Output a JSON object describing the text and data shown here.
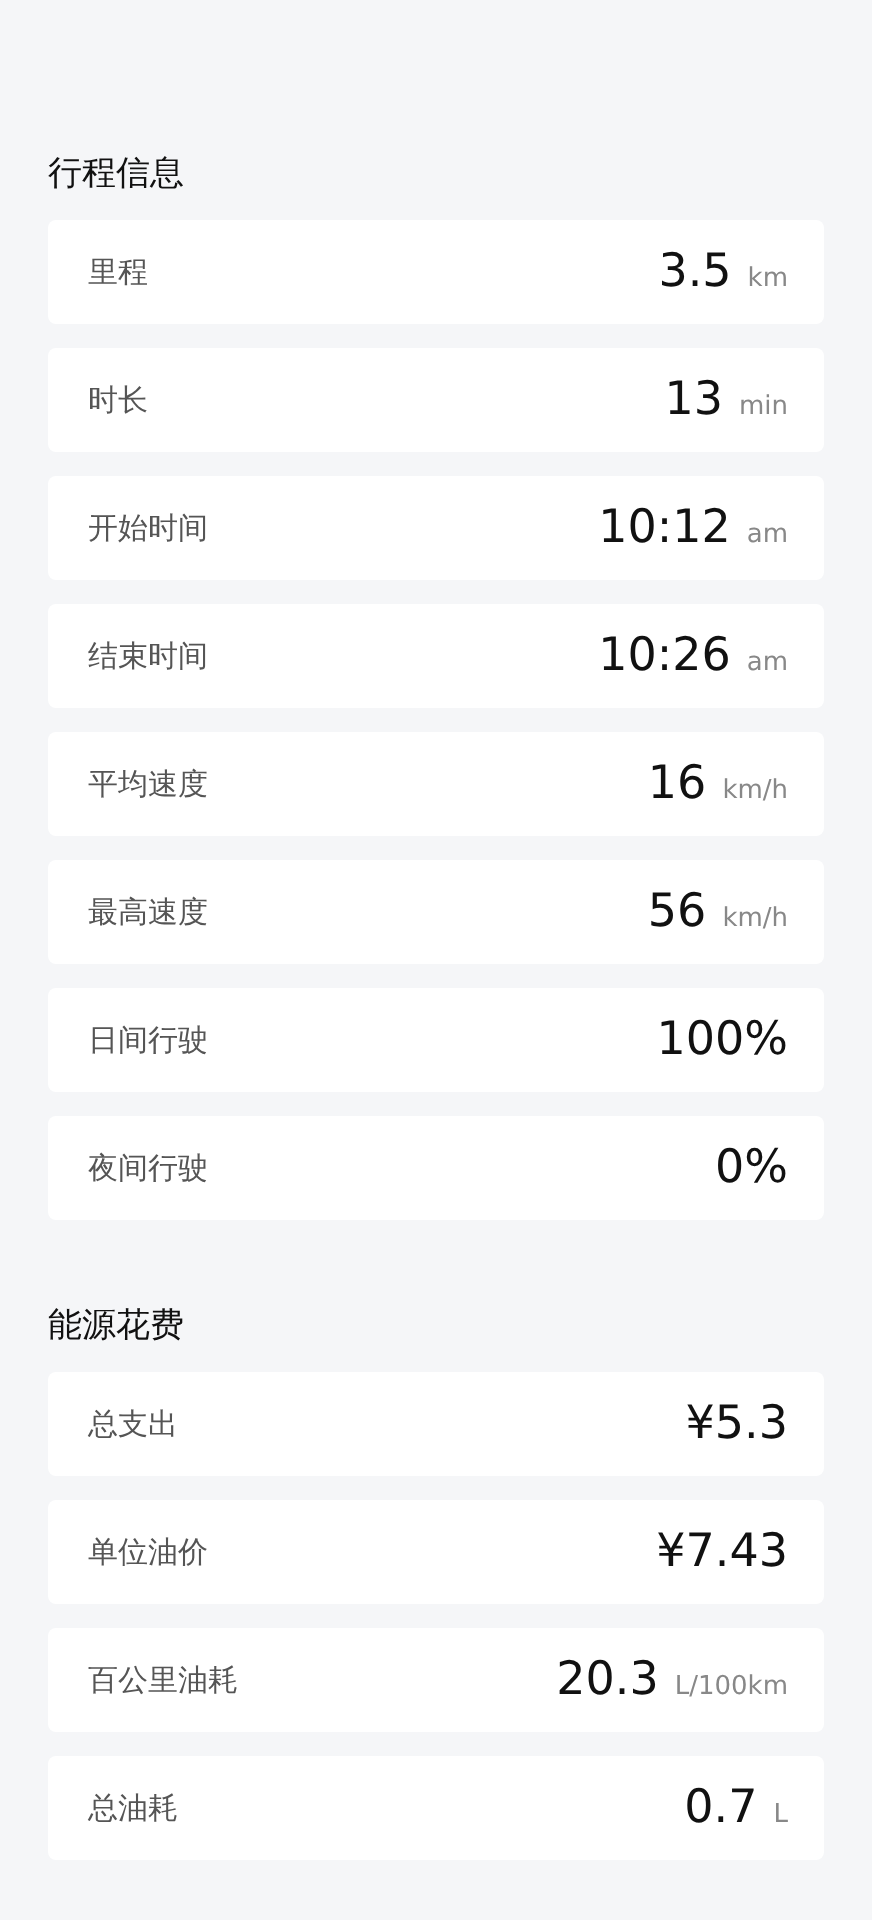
{
  "sections": [
    {
      "title": "行程信息",
      "rows": [
        {
          "label": "里程",
          "value": "3.5",
          "unit": "km"
        },
        {
          "label": "时长",
          "value": "13",
          "unit": "min"
        },
        {
          "label": "开始时间",
          "value": "10:12",
          "unit": "am"
        },
        {
          "label": "结束时间",
          "value": "10:26",
          "unit": "am"
        },
        {
          "label": "平均速度",
          "value": "16",
          "unit": "km/h"
        },
        {
          "label": "最高速度",
          "value": "56",
          "unit": "km/h"
        },
        {
          "label": "日间行驶",
          "value": "100%"
        },
        {
          "label": "夜间行驶",
          "value": "0%"
        }
      ]
    },
    {
      "title": "能源花费",
      "rows": [
        {
          "label": "总支出",
          "value": "¥5.3"
        },
        {
          "label": "单位油价",
          "value": "¥7.43"
        },
        {
          "label": "百公里油耗",
          "value": "20.3",
          "unit": "L/100km"
        },
        {
          "label": "总油耗",
          "value": "0.7",
          "unit": "L"
        }
      ]
    }
  ]
}
